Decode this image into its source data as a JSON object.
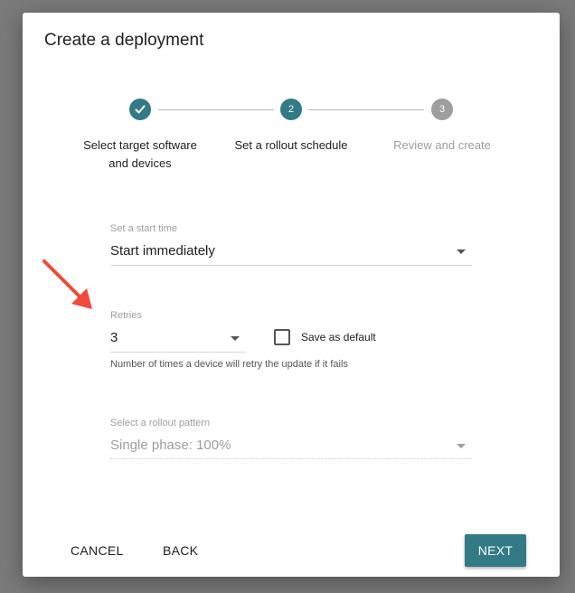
{
  "dialog": {
    "title": "Create a deployment"
  },
  "stepper": {
    "steps": [
      {
        "label_line1": "Select target software",
        "label_line2": "and devices",
        "state": "completed"
      },
      {
        "number": "2",
        "label": "Set a rollout schedule",
        "state": "active"
      },
      {
        "number": "3",
        "label": "Review and create",
        "state": "inactive"
      }
    ]
  },
  "start_time": {
    "label": "Set a start time",
    "value": "Start immediately"
  },
  "retries": {
    "label": "Retries",
    "value": "3",
    "save_default_label": "Save as default",
    "save_default_checked": false,
    "helper": "Number of times a device will retry the update if it fails"
  },
  "rollout_pattern": {
    "label": "Select a rollout pattern",
    "value": "Single phase: 100%",
    "disabled": true
  },
  "actions": {
    "cancel": "CANCEL",
    "back": "BACK",
    "next": "NEXT"
  },
  "colors": {
    "accent": "#337a87",
    "inactive": "#9e9e9e",
    "annotation_arrow": "#f04a3c"
  },
  "icons": {
    "completed_step": "check-icon",
    "dropdown": "caret-down-icon",
    "annotation": "red-arrow-icon"
  }
}
